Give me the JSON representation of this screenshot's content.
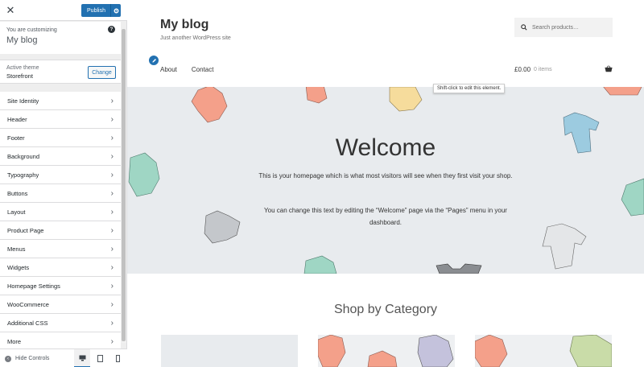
{
  "customizer": {
    "close_icon": "close-icon",
    "publish_label": "Publish",
    "settings_icon": "gear-icon",
    "customizing_label": "You are customizing",
    "blog_name": "My blog",
    "help_icon": "help-icon",
    "active_theme_label": "Active theme",
    "theme_name": "Storefront",
    "change_label": "Change",
    "sections": [
      {
        "label": "Site Identity"
      },
      {
        "label": "Header"
      },
      {
        "label": "Footer"
      },
      {
        "label": "Background"
      },
      {
        "label": "Typography"
      },
      {
        "label": "Buttons"
      },
      {
        "label": "Layout"
      },
      {
        "label": "Product Page"
      },
      {
        "label": "Menus"
      },
      {
        "label": "Widgets"
      },
      {
        "label": "Homepage Settings"
      },
      {
        "label": "WooCommerce"
      },
      {
        "label": "Additional CSS"
      },
      {
        "label": "More"
      }
    ],
    "hide_controls_label": "Hide Controls",
    "devices": [
      "desktop",
      "tablet",
      "mobile"
    ]
  },
  "site": {
    "title": "My blog",
    "tagline": "Just another WordPress site",
    "search_placeholder": "Search products…",
    "nav": [
      "About",
      "Contact"
    ],
    "cart_total": "£0.00",
    "cart_count": "0 items",
    "tooltip": "Shift-click to edit this element."
  },
  "hero": {
    "title": "Welcome",
    "paragraph1": "This is your homepage which is what most visitors will see when they first visit your shop.",
    "paragraph2": "You can change this text by editing the “Welcome” page via the “Pages” menu in your dashboard."
  },
  "shop": {
    "title": "Shop by Category"
  },
  "colors": {
    "accent": "#2271b1",
    "hero_bg": "#e8ebee",
    "coral": "#f4a08a",
    "mint": "#9fd6c4",
    "sky": "#9ccbe0",
    "yellow": "#f6dc9c",
    "grey": "#b5b8bc"
  }
}
